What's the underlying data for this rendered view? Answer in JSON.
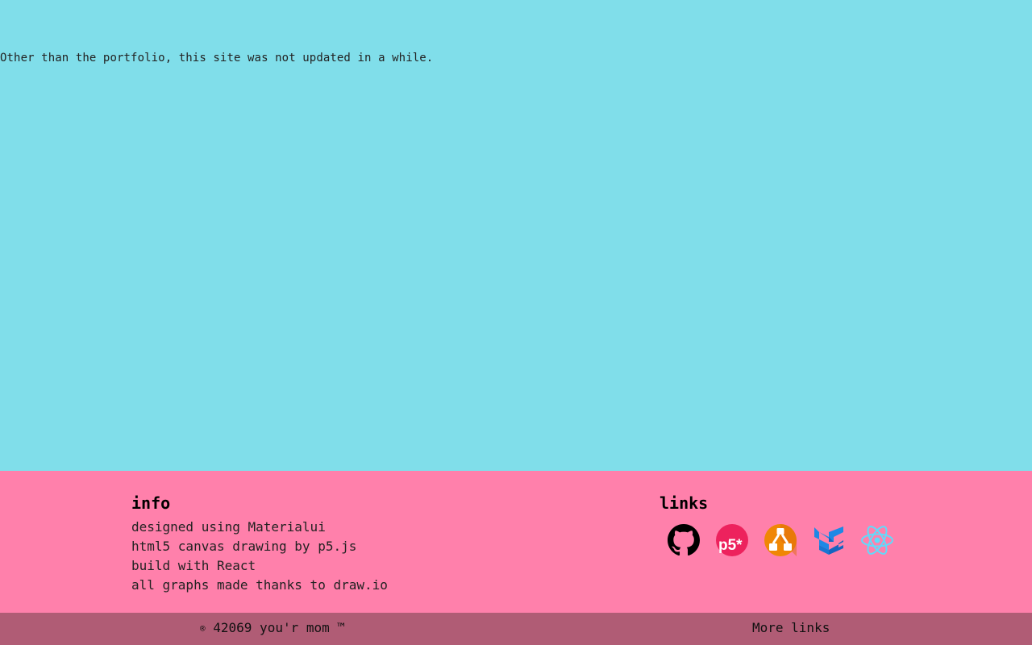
{
  "main": {
    "notice": "Other than the portfolio, this site was not updated in a while."
  },
  "footer": {
    "info": {
      "heading": "info",
      "lines": [
        "designed using Materialui",
        "html5 canvas drawing by p5.js",
        "build with React",
        "all graphs made thanks to draw.io"
      ]
    },
    "links": {
      "heading": "links",
      "icons": [
        {
          "name": "github-icon",
          "label": "GitHub"
        },
        {
          "name": "p5js-icon",
          "label": "p5.js",
          "text": "p5*"
        },
        {
          "name": "drawio-icon",
          "label": "draw.io"
        },
        {
          "name": "materialui-icon",
          "label": "Material-UI"
        },
        {
          "name": "react-icon",
          "label": "React"
        }
      ]
    }
  },
  "bottom_bar": {
    "copyright_symbol": "®",
    "copyright_text": " 42069 you'r mom ™",
    "more_links": "More links"
  },
  "colors": {
    "main_bg": "#80deea",
    "footer_bg": "#ff80ab",
    "bottom_bar_bg": "#b05c75",
    "p5_pink": "#ed225d",
    "drawio_orange": "#f08705",
    "mui_blue": "#1e88e5",
    "react_blue": "#61dafb"
  }
}
